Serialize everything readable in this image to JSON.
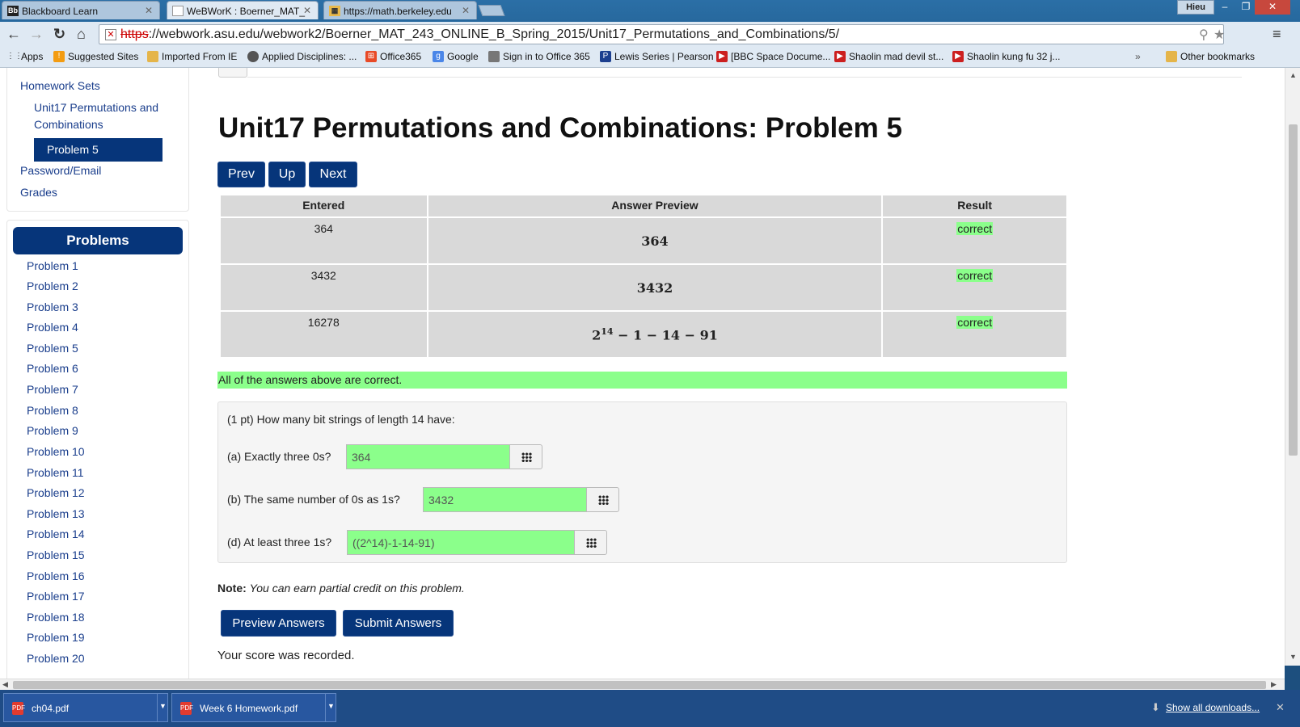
{
  "browser": {
    "tabs": [
      {
        "icon": "Bb",
        "label": "Blackboard Learn"
      },
      {
        "icon": "doc",
        "label": "WeBWorK : Boerner_MAT_"
      },
      {
        "icon": "cal",
        "label": "https://math.berkeley.edu"
      }
    ],
    "user": "Hieu",
    "url_scheme": "https",
    "url_rest": "://webwork.asu.edu/webwork2/Boerner_MAT_243_ONLINE_B_Spring_2015/Unit17_Permutations_and_Combinations/5/",
    "bookmarks": [
      "Apps",
      "Suggested Sites",
      "Imported From IE",
      "Applied Disciplines: ...",
      "Office365",
      "Google",
      "Sign in to Office 365",
      "Lewis Series | Pearson",
      "[BBC Space Docume...",
      "Shaolin mad devil st...",
      "Shaolin kung fu 32 j..."
    ],
    "bookmarks_overflow": "»",
    "other_bookmarks": "Other bookmarks"
  },
  "sidebar": {
    "homework_sets": "Homework Sets",
    "set_line1": "Unit17 Permutations and",
    "set_line2": "Combinations",
    "active_problem": "Problem 5",
    "password_email": "Password/Email",
    "grades": "Grades",
    "problems_header": "Problems",
    "problems": [
      "Problem 1",
      "Problem 2",
      "Problem 3",
      "Problem 4",
      "Problem 5",
      "Problem 6",
      "Problem 7",
      "Problem 8",
      "Problem 9",
      "Problem 10",
      "Problem 11",
      "Problem 12",
      "Problem 13",
      "Problem 14",
      "Problem 15",
      "Problem 16",
      "Problem 17",
      "Problem 18",
      "Problem 19",
      "Problem 20"
    ]
  },
  "main": {
    "title": "Unit17 Permutations and Combinations: Problem 5",
    "nav": {
      "prev": "Prev",
      "up": "Up",
      "next": "Next"
    },
    "results": {
      "headers": {
        "entered": "Entered",
        "preview": "Answer Preview",
        "result": "Result"
      },
      "rows": [
        {
          "entered": "364",
          "preview": "364",
          "result": "correct"
        },
        {
          "entered": "3432",
          "preview": "3432",
          "result": "correct"
        },
        {
          "entered": "16278",
          "preview_base": "2",
          "preview_exp": "14",
          "preview_rest": " − 1 − 14 − 91",
          "result": "correct"
        }
      ]
    },
    "all_correct": "All of the answers above are correct.",
    "problem": {
      "intro": "(1 pt) How many bit strings of length 14 have:",
      "questions": [
        {
          "label": "(a) Exactly three 0s?",
          "answer": "364"
        },
        {
          "label": "(b) The same number of 0s as 1s?",
          "answer": "3432"
        },
        {
          "label": "(d) At least three 1s?",
          "answer": "((2^14)-1-14-91)"
        }
      ]
    },
    "note_label": "Note:",
    "note_text": "You can earn partial credit on this problem.",
    "preview_button": "Preview Answers",
    "submit_button": "Submit Answers",
    "score_message": "Your score was recorded."
  },
  "downloads": {
    "items": [
      "ch04.pdf",
      "Week 6 Homework.pdf"
    ],
    "show_all": "Show all downloads..."
  },
  "colors": {
    "brand_navy": "#06357a",
    "correct_green": "#8bff8b",
    "table_gray": "#d9d9d9"
  }
}
